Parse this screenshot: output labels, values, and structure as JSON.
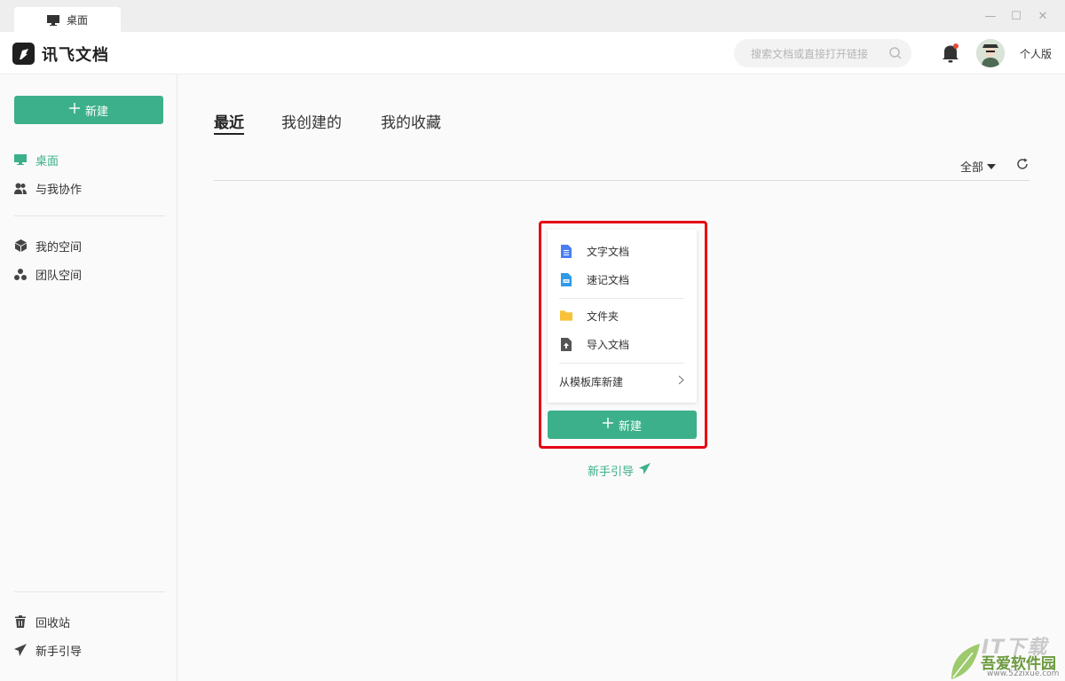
{
  "window": {
    "tab_label": "桌面",
    "minimize": "—",
    "maximize": "☐",
    "close": "✕"
  },
  "header": {
    "brand": "讯飞文档",
    "search_placeholder": "搜索文档或直接打开链接",
    "edition": "个人版"
  },
  "sidebar": {
    "new_button": "新建",
    "items": [
      {
        "label": "桌面",
        "icon": "monitor-icon",
        "active": true
      },
      {
        "label": "与我协作",
        "icon": "users-icon"
      },
      {
        "label": "我的空间",
        "icon": "cube-icon"
      },
      {
        "label": "团队空间",
        "icon": "team-icon"
      }
    ],
    "bottom_items": [
      {
        "label": "回收站",
        "icon": "trash-icon"
      },
      {
        "label": "新手引导",
        "icon": "paper-plane-icon"
      }
    ]
  },
  "main": {
    "tabs": [
      {
        "label": "最近",
        "active": true
      },
      {
        "label": "我创建的"
      },
      {
        "label": "我的收藏"
      }
    ],
    "filter_label": "全部",
    "create_menu": {
      "items": [
        {
          "label": "文字文档",
          "icon": "doc-icon"
        },
        {
          "label": "速记文档",
          "icon": "shorthand-doc-icon"
        },
        {
          "label": "文件夹",
          "icon": "folder-icon"
        },
        {
          "label": "导入文档",
          "icon": "import-icon"
        }
      ],
      "template_label": "从模板库新建"
    },
    "new_button": "新建",
    "guide_link": "新手引导"
  },
  "watermark": {
    "line1": "IT下载",
    "line2": "吾爱软件园",
    "line3": "www.52zixue.com"
  },
  "colors": {
    "accent": "#3cb08a",
    "highlight": "#e60012",
    "doc_blue": "#4a7ef5",
    "shorthand_blue": "#2f9ae8",
    "folder_yellow": "#f7c23a"
  }
}
